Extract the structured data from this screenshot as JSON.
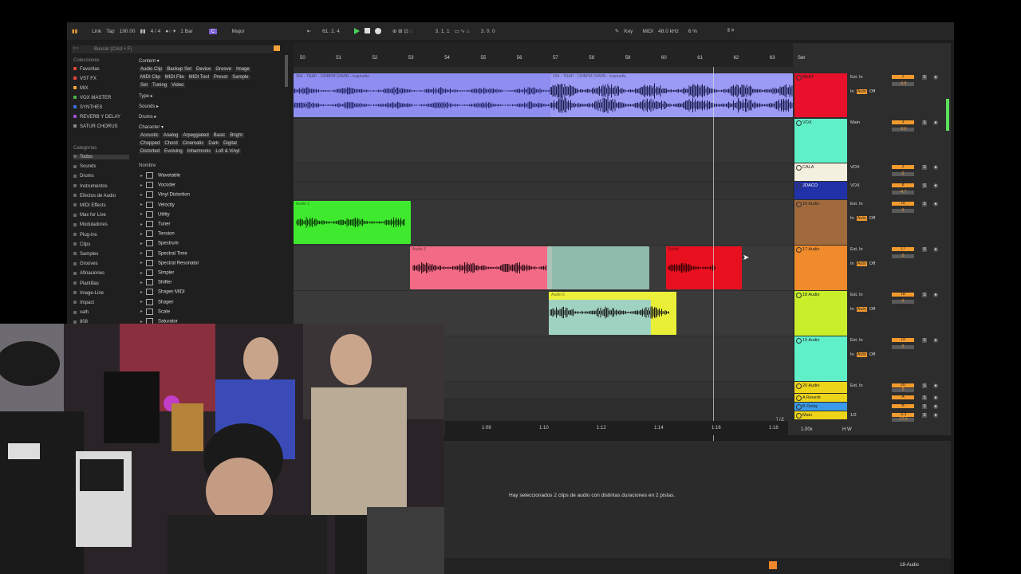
{
  "topbar": {
    "link": "Link",
    "tap": "Tap",
    "tempo": "190.00",
    "signature": "4 / 4",
    "quant": "1 Bar",
    "key": "C",
    "scale": "Major",
    "position": "61. 2. 4",
    "loop_start": "3. 1. 1",
    "loop_len": "3. 0. 0",
    "key_btn": "Key",
    "midi_btn": "MIDI",
    "sample_rate": "48.0 kHz",
    "cpu": "6 %"
  },
  "browser": {
    "search_placeholder": "Buscar (Cmd + F)",
    "collections_title": "Colecciones",
    "collections": [
      {
        "label": "Favoritas",
        "color": "#e0453a"
      },
      {
        "label": "VST FX",
        "color": "#e0453a"
      },
      {
        "label": "MIX",
        "color": "#f2a33a"
      },
      {
        "label": "VOX MASTER",
        "color": "#4ab04a"
      },
      {
        "label": "SYNTHES",
        "color": "#3b6fe0"
      },
      {
        "label": "REVERB Y DELAY",
        "color": "#9b4fd1"
      },
      {
        "label": "SATUR CHORUS",
        "color": "#8a8a8a"
      }
    ],
    "categories_title": "Categorías",
    "categories": [
      "Todos",
      "Sounds",
      "Drums",
      "Instrumentos",
      "Efectos de Audio",
      "MIDI Effects",
      "Max for Live",
      "Moduladores",
      "Plug-ins",
      "Clips",
      "Samples",
      "Grooves",
      "Afinaciones",
      "Plantillas",
      "Image-Line",
      "Impact",
      "valh",
      "808"
    ],
    "content_title": "Content ▾",
    "content_row1": [
      "Audio Clip",
      "Backup Set",
      "Device",
      "Groove",
      "Image"
    ],
    "content_row2": [
      "MIDI Clip",
      "MIDI File",
      "MIDI Tool",
      "Preset",
      "Sample"
    ],
    "content_row3": [
      "Set",
      "Tuning",
      "Video"
    ],
    "type": "Type ▸",
    "sounds": "Sounds ▸",
    "drums": "Drums ▸",
    "character": "Character ▾",
    "char_row1": [
      "Acoustic",
      "Analog",
      "Arpeggiated",
      "Basic",
      "Bright"
    ],
    "char_row2": [
      "Chopped",
      "Chord",
      "Cinematic",
      "Dark",
      "Digital"
    ],
    "char_row3": [
      "Distorted",
      "Evolving",
      "Inharmonic",
      "Lofi & Vinyl"
    ],
    "name_header": "Nombre",
    "devices": [
      "Wavetable",
      "Vocoder",
      "Vinyl Distortion",
      "Velocity",
      "Utility",
      "Tuner",
      "Tension",
      "Spectrum",
      "Spectral Time",
      "Spectral Resonator",
      "Simpler",
      "Shifter",
      "Shaper MIDI",
      "Shaper",
      "Scale",
      "Saturator"
    ]
  },
  "ruler": {
    "bars": [
      "50",
      "51",
      "52",
      "53",
      "54",
      "55",
      "56",
      "57",
      "58",
      "59",
      "60",
      "61",
      "62",
      "63"
    ],
    "set_label": "Set"
  },
  "clips": {
    "beat": "254 - TRAP - 190BPM D#MIN - trapmafia",
    "beat2": "254 - TRAP - 190BPM D#MIN - trapmafia",
    "audio1": "Audio 1",
    "audio3": "Audio 3",
    "audio6": "Audio 6",
    "audio_red": "Audio"
  },
  "tracks": [
    {
      "name": "BEAT",
      "color": "#e8102a",
      "vol": "2",
      "meter": "-3.9"
    },
    {
      "name": "VOX",
      "color": "#5ff0c8",
      "vol": "3",
      "meter": "-3.9"
    },
    {
      "name": "CALA",
      "color": "#f4f0e0",
      "vol": "3",
      "meter": "0"
    },
    {
      "name": "JOACO",
      "color": "#2131a8",
      "vol": "8",
      "meter": "-4.7"
    },
    {
      "name": "16 Audio",
      "color": "#a06a3c",
      "vol": "16",
      "meter": "0"
    },
    {
      "name": "17 Audio",
      "color": "#f08a2a",
      "vol": "17",
      "meter": "0"
    },
    {
      "name": "18 Audio",
      "color": "#c8ef2a",
      "vol": "18",
      "meter": "0"
    },
    {
      "name": "19 Audio",
      "color": "#5ff0c8",
      "vol": "19",
      "meter": "0"
    },
    {
      "name": "20 Audio",
      "color": "#ecd41a",
      "vol": "20",
      "meter": "0"
    },
    {
      "name": "A Reverb",
      "color": "#ecd41a",
      "vol": "A",
      "meter": ""
    },
    {
      "name": "B Delay",
      "color": "#3a9be8",
      "vol": "B",
      "meter": ""
    },
    {
      "name": "Main",
      "color": "#ecd41a",
      "vol": "-3.3",
      "meter": "-17.0"
    }
  ],
  "mixer": {
    "ext_in": "Ext. In",
    "main": "Main",
    "vox": "VOX",
    "auto": "Auto",
    "off": "Off",
    "in": "In",
    "fraction": "1/2",
    "quarter": "1/4",
    "zoom": "1.00x"
  },
  "timeline": [
    "1:08",
    "1:10",
    "1:12",
    "1:14",
    "1:16",
    "1:18"
  ],
  "status": {
    "message": "Hay seleccionados 2 clips de audio con distintas duraciones en 2 pistas.",
    "track": "18-Audio"
  }
}
